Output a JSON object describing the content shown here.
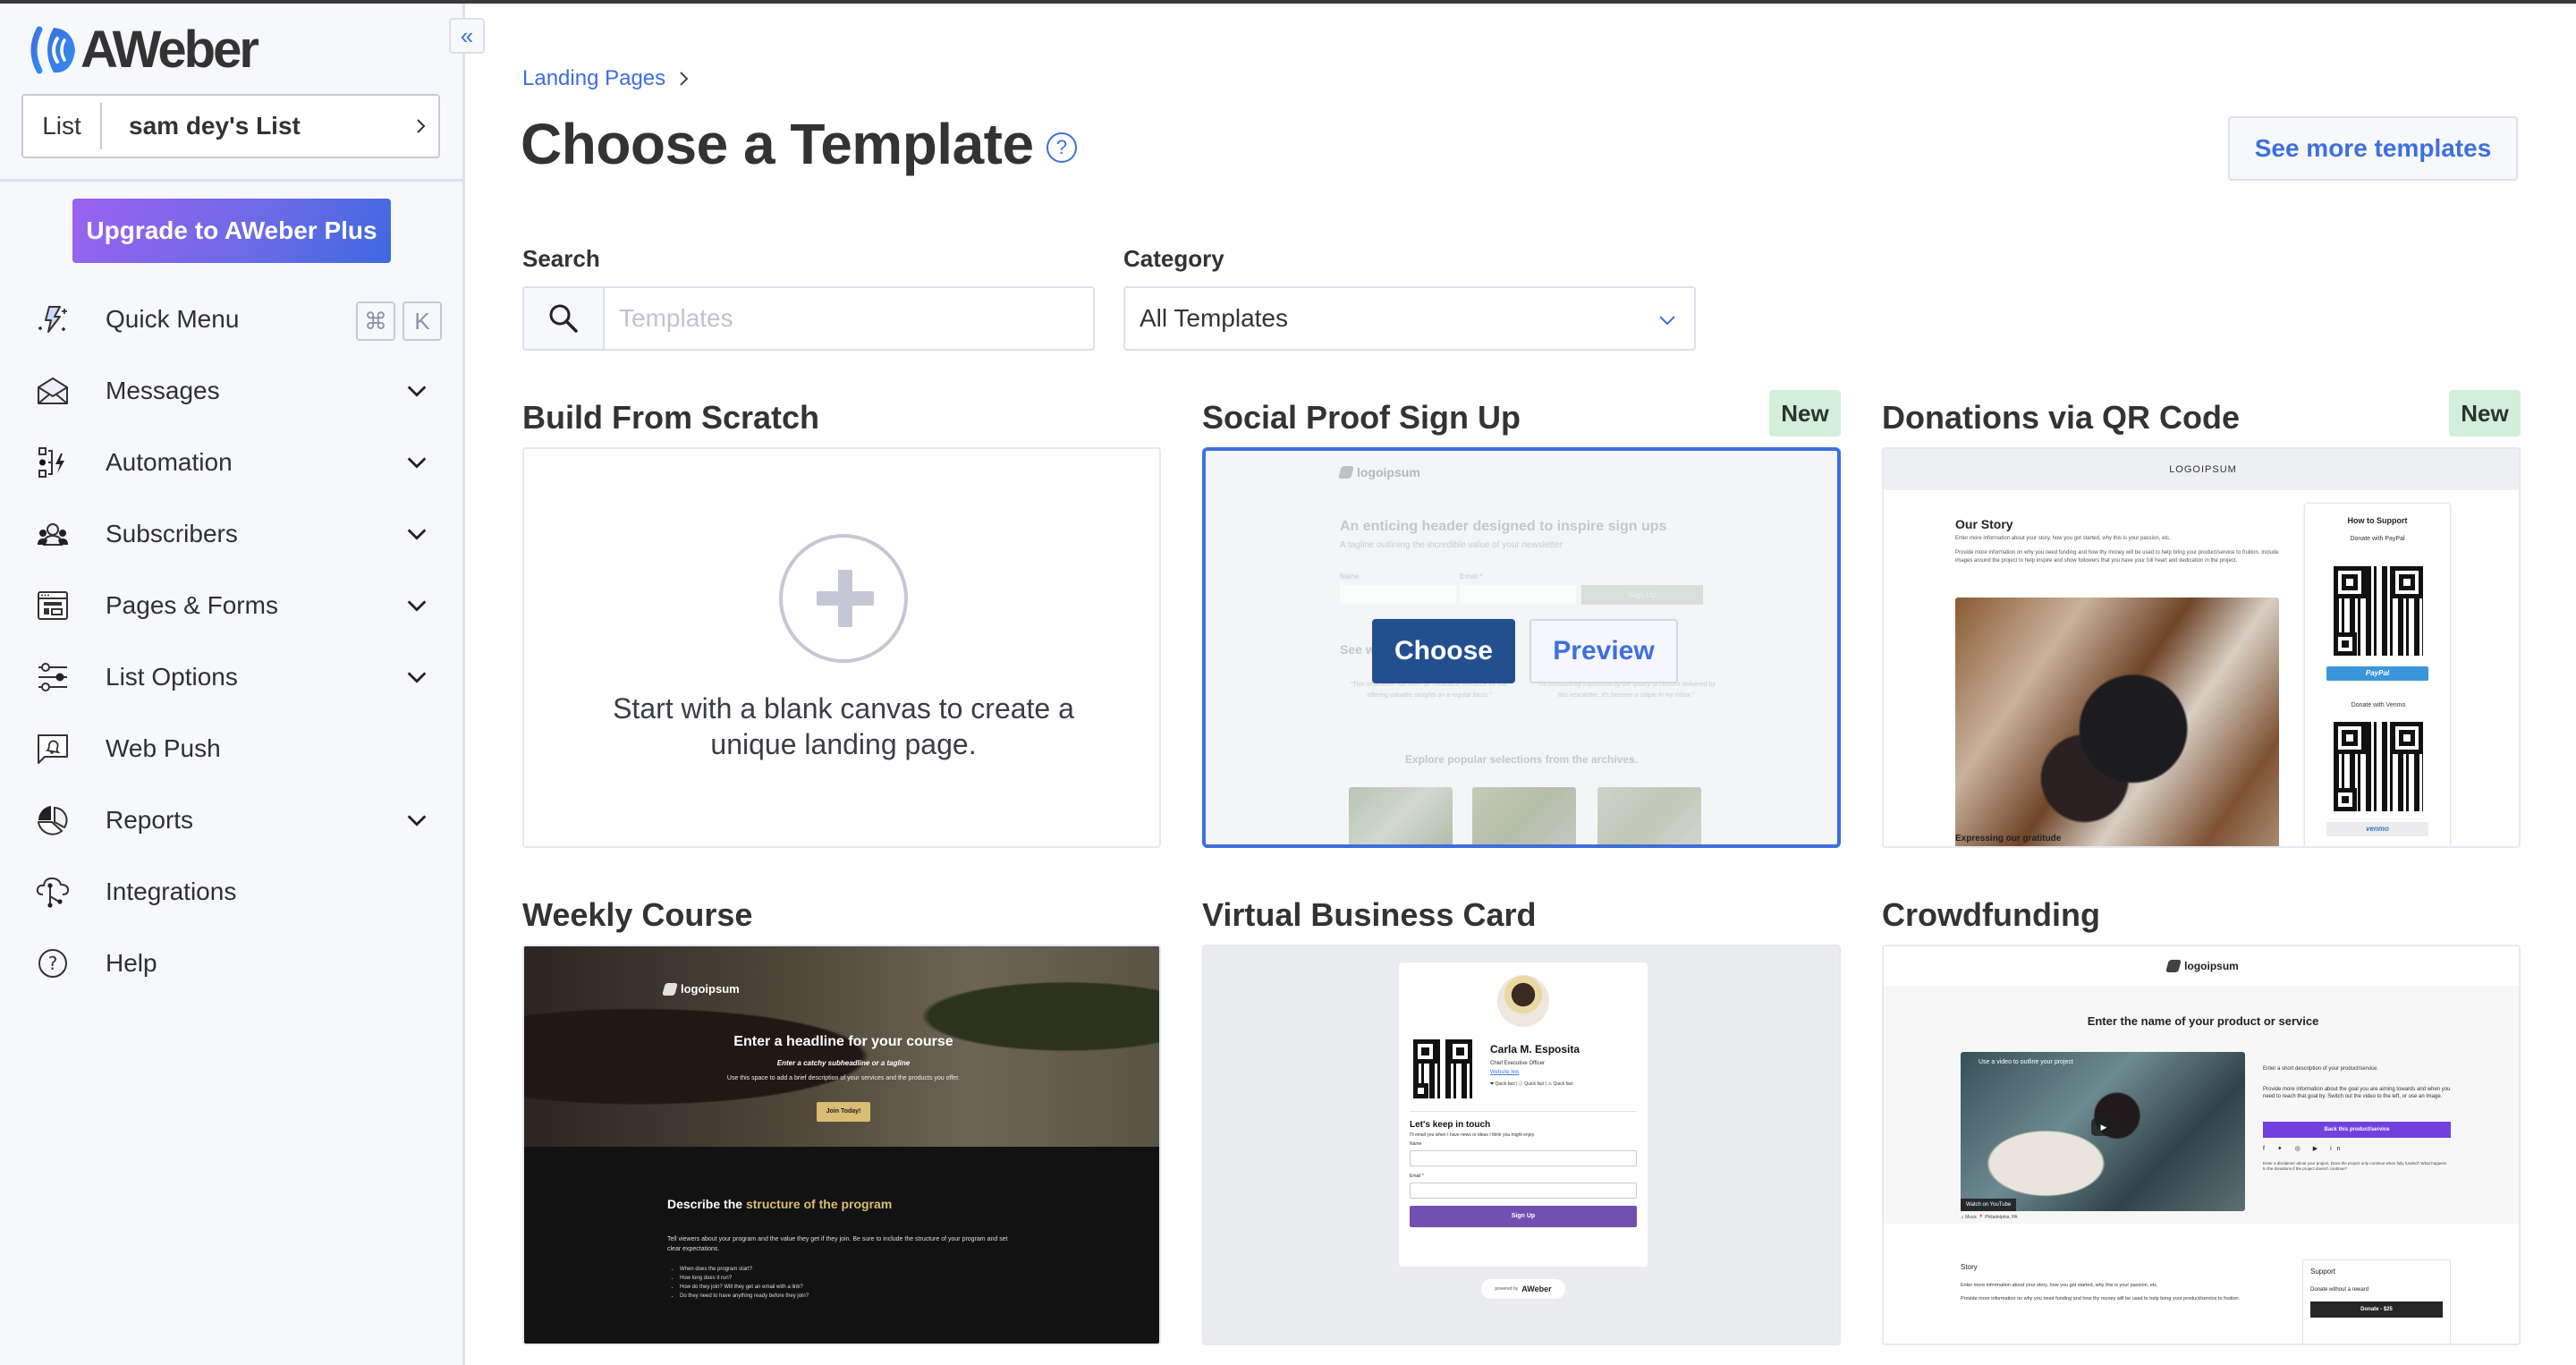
{
  "sidebar": {
    "brand": "AWeber",
    "collapse_icon": "double-chevron-left-icon",
    "list_selector": {
      "label": "List",
      "value": "sam dey's List"
    },
    "upgrade_button": "Upgrade to AWeber Plus",
    "quick_menu": {
      "label": "Quick Menu",
      "shortcut": [
        "⌘",
        "K"
      ]
    },
    "items": [
      {
        "label": "Messages",
        "icon": "envelope-icon",
        "expandable": true
      },
      {
        "label": "Automation",
        "icon": "automation-icon",
        "expandable": true
      },
      {
        "label": "Subscribers",
        "icon": "people-icon",
        "expandable": true
      },
      {
        "label": "Pages & Forms",
        "icon": "browser-layout-icon",
        "expandable": true
      },
      {
        "label": "List Options",
        "icon": "sliders-icon",
        "expandable": true
      },
      {
        "label": "Web Push",
        "icon": "bell-message-icon",
        "expandable": false
      },
      {
        "label": "Reports",
        "icon": "pie-chart-icon",
        "expandable": true
      },
      {
        "label": "Integrations",
        "icon": "cloud-network-icon",
        "expandable": false
      },
      {
        "label": "Help",
        "icon": "question-circle-icon",
        "expandable": false
      }
    ]
  },
  "header": {
    "breadcrumb": "Landing Pages",
    "title": "Choose a Template",
    "see_more_button": "See more templates"
  },
  "filters": {
    "search_label": "Search",
    "search_placeholder": "Templates",
    "search_value": "",
    "category_label": "Category",
    "category_value": "All Templates"
  },
  "templates": [
    {
      "title": "Build From Scratch",
      "is_new": false,
      "description": "Start with a blank canvas to create a unique landing page."
    },
    {
      "title": "Social Proof Sign Up",
      "is_new": true,
      "new_label": "New",
      "selected": true,
      "choose_label": "Choose",
      "preview_label": "Preview",
      "preview": {
        "logo": "logoipsum",
        "headline": "An enticing header designed to inspire sign ups",
        "tagline": "A tagline outlining the incredible value of your newsletter",
        "name_label": "Name",
        "email_label": "Email *",
        "signup": "Sign Up",
        "section": "See what readers have to say",
        "quote1": "\"This newsletter has been an invaluable resource for me, offering valuable insights on a regular basis.\"",
        "quote2": "\"I'm consistently impressed by the quality of content delivered by this newsletter. It's become a staple in my inbox.\"",
        "archives": "Explore popular selections from the archives."
      }
    },
    {
      "title": "Donations via QR Code",
      "is_new": true,
      "new_label": "New",
      "preview": {
        "logo": "LOGOIPSUM",
        "story_title": "Our Story",
        "story_p1": "Enter more information about your story, how you got started, why this is your passion, etc.",
        "story_p2": "Provide more information on why you need funding and how thy money will be used to help bring your product/service to fruition. Include images around the project to help inspire and show followers that you have your full heart and dedication in the project.",
        "support_title": "How to Support",
        "paypal_label": "Donate with PayPal",
        "paypal_button": "PayPal",
        "venmo_label": "Donate with Venmo",
        "venmo_button": "venmo",
        "gratitude": "Expressing our gratitude"
      }
    },
    {
      "title": "Weekly Course",
      "is_new": false,
      "preview": {
        "logo": "logoipsum",
        "headline": "Enter a headline for your course",
        "subheadline": "Enter a catchy subheadline or a tagline",
        "description": "Use this space to add a brief description of your services and the products you offer.",
        "cta": "Join Today!",
        "section_white": "Describe the ",
        "section_gold": "structure of the program",
        "body": "Tell viewers about your program and the value they get if they join. Be sure to include the structure of your program and set clear expectations.",
        "bullets": [
          "When does the program start?",
          "How long does it run?",
          "How do they join? Will they get an email with a link?",
          "Do they need to have anything ready before they join?"
        ]
      }
    },
    {
      "title": "Virtual Business Card",
      "is_new": false,
      "preview": {
        "name": "Carla M. Esposita",
        "role": "Chief Executive Officer",
        "link": "Website link",
        "facts": "❤ Quick fact | ⓘ Quick fact | ⚠ Quick fact",
        "keep_in_touch": "Let's keep in touch",
        "subtext": "I'll email you when I have news or ideas I think you might enjoy.",
        "name_label": "Name",
        "email_label": "Email *",
        "signup": "Sign Up",
        "powered_by": "powered by",
        "powered_brand": "AWeber"
      }
    },
    {
      "title": "Crowdfunding",
      "is_new": false,
      "preview": {
        "logo": "logoipsum",
        "headline": "Enter the name of your product or service",
        "video_caption": "Use a video to outline your project",
        "watch_on": "Watch on YouTube",
        "tags": "♫ Music 📍 Philadelphia, PA",
        "short_desc": "Enter a short description of your product/service.",
        "long_desc": "Provide more information about the goal you are aiming towards and when you need to reach that goal by. Switch out the video to the left, or use an image.",
        "back_button": "Back this product/service",
        "disclaimer": "Enter a disclaimer about your project. Does the project only continue when fully funded? What happens to the donations if the project doesn't continue?",
        "story": "Story",
        "story_p1": "Enter more information about your story, how you got started, why this is your passion, etc.",
        "story_p2": "Provide more information on why you need funding and how thy money will be used to help bring your product/service to fruition.",
        "support": "Support",
        "donate_without": "Donate without a reward",
        "donate_button": "Donate - $25"
      }
    }
  ],
  "colors": {
    "accent": "#3d6fde",
    "choose_button": "#22508f",
    "new_badge": "#d2f0d9",
    "sidebar_bg": "#f7f8fc",
    "upgrade_gradient_start": "#9c62f0",
    "upgrade_gradient_end": "#3d69e0"
  }
}
